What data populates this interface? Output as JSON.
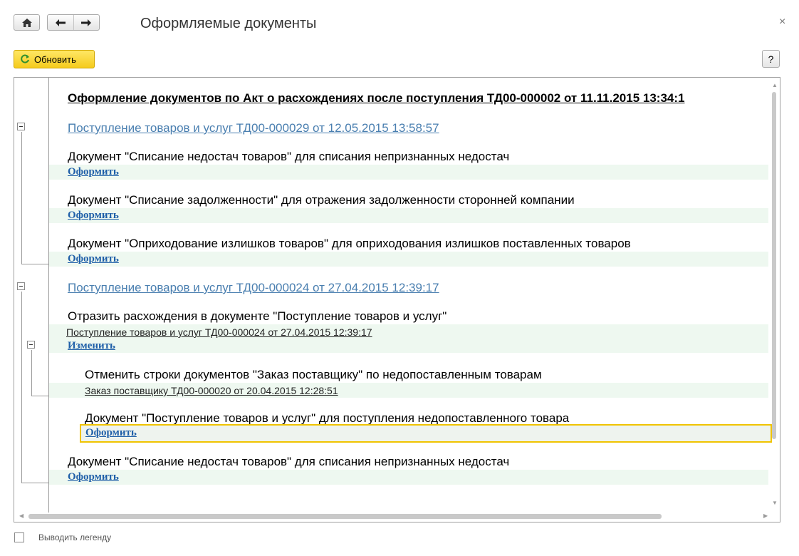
{
  "window": {
    "title": "Оформляемые документы",
    "close": "×"
  },
  "toolbar": {
    "refresh_label": "Обновить",
    "help_label": "?"
  },
  "report": {
    "header": "Оформление документов по Акт о расхождениях после поступления ТД00-000002 от 11.11.2015 13:34:1",
    "groups": [
      {
        "link": "Поступление товаров и услуг ТД00-000029 от 12.05.2015 13:58:57",
        "items": [
          {
            "text": "Документ \"Списание недостач товаров\" для списания непризнанных недостач",
            "action": "Оформить"
          },
          {
            "text": "Документ \"Списание задолженности\" для отражения задолженности сторонней компании",
            "action": "Оформить"
          },
          {
            "text": "Документ \"Оприходование излишков товаров\" для оприходования излишков поставленных товаров",
            "action": "Оформить"
          }
        ]
      },
      {
        "link": "Поступление товаров и услуг ТД00-000024 от 27.04.2015 12:39:17",
        "reflect": {
          "text": "Отразить расхождения в документе \"Поступление товаров и услуг\"",
          "sublink": "Поступление товаров и услуг ТД00-000024 от 27.04.2015 12:39:17",
          "action": "Изменить",
          "children": [
            {
              "text": "Отменить строки документов \"Заказ поставщику\" по недопоставленным товарам",
              "sublink": "Заказ поставщику ТД00-000020 от 20.04.2015 12:28:51"
            },
            {
              "text": "Документ \"Поступление товаров и услуг\" для поступления недопоставленного товара",
              "action": "Оформить"
            }
          ]
        },
        "items": [
          {
            "text": "Документ \"Списание недостач товаров\" для списания непризнанных недостач",
            "action": "Оформить"
          }
        ]
      }
    ]
  },
  "footer": {
    "legend_label": "Выводить легенду",
    "legend_checked": false
  },
  "colors": {
    "link": "#4a7fb0",
    "action": "#1f5fa8",
    "accent_yellow": "#f5cb1c",
    "band": "#eef8f0"
  }
}
